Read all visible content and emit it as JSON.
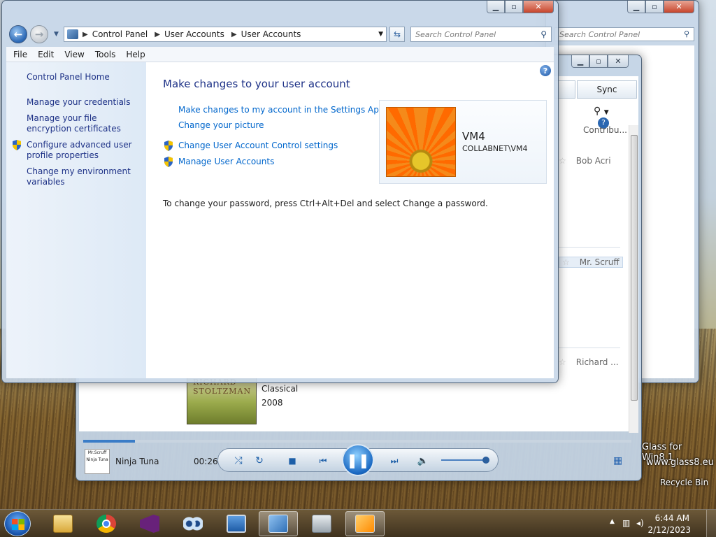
{
  "desktop": {
    "watermark_line1": "Glass for Win8.1",
    "watermark_line2": "www.glass8.eu",
    "recycle_bin_label": "Recycle Bin"
  },
  "bg_control_panel": {
    "search_placeholder": "Search Control Panel"
  },
  "media_player": {
    "sync_tab": "Sync",
    "column_contributing": "Contribu...",
    "rows": [
      {
        "contributor": "Bob Acri"
      },
      {
        "contributor": "Mr. Scruff"
      },
      {
        "contributor": "Richard ..."
      }
    ],
    "album": {
      "art_text_line1": "RICHARD",
      "art_text_line2": "STOLTZMAN",
      "genre": "Classical",
      "year": "2008"
    },
    "now_playing": {
      "art_text": "Mr.Scruff Ninja Tuna",
      "title": "Ninja Tuna",
      "time": "00:26",
      "progress_fraction": 0.095
    },
    "volume_fraction": 1.0
  },
  "control_panel": {
    "breadcrumbs": [
      "Control Panel",
      "User Accounts",
      "User Accounts"
    ],
    "search_placeholder": "Search Control Panel",
    "menu": [
      "File",
      "Edit",
      "View",
      "Tools",
      "Help"
    ],
    "sidebar": {
      "home": "Control Panel Home",
      "links": [
        {
          "label": "Manage your credentials",
          "shield": false
        },
        {
          "label": "Manage your file encryption certificates",
          "shield": false
        },
        {
          "label": "Configure advanced user profile properties",
          "shield": true
        },
        {
          "label": "Change my environment variables",
          "shield": false
        }
      ]
    },
    "main": {
      "title": "Make changes to your user account",
      "links": [
        {
          "label": "Make changes to my account in the Settings App",
          "shield": false
        },
        {
          "label": "Change your picture",
          "shield": false
        },
        {
          "label": "Change User Account Control settings",
          "shield": true
        },
        {
          "label": "Manage User Accounts",
          "shield": true
        }
      ],
      "password_note": "To change your password, press Ctrl+Alt+Del and select Change a password.",
      "user": {
        "name": "VM4",
        "domain": "COLLABNET\\VM4"
      }
    }
  },
  "taskbar": {
    "clock_time": "6:44 AM",
    "clock_date": "2/12/2023",
    "apps": [
      "file-explorer",
      "chrome",
      "visual-studio",
      "remote-assist",
      "remote-desktop",
      "control-panel",
      "system-backup",
      "media-player"
    ]
  },
  "colors": {
    "link": "#0066cc",
    "heading": "#1e3287",
    "accent_blue": "#1a57b0"
  }
}
